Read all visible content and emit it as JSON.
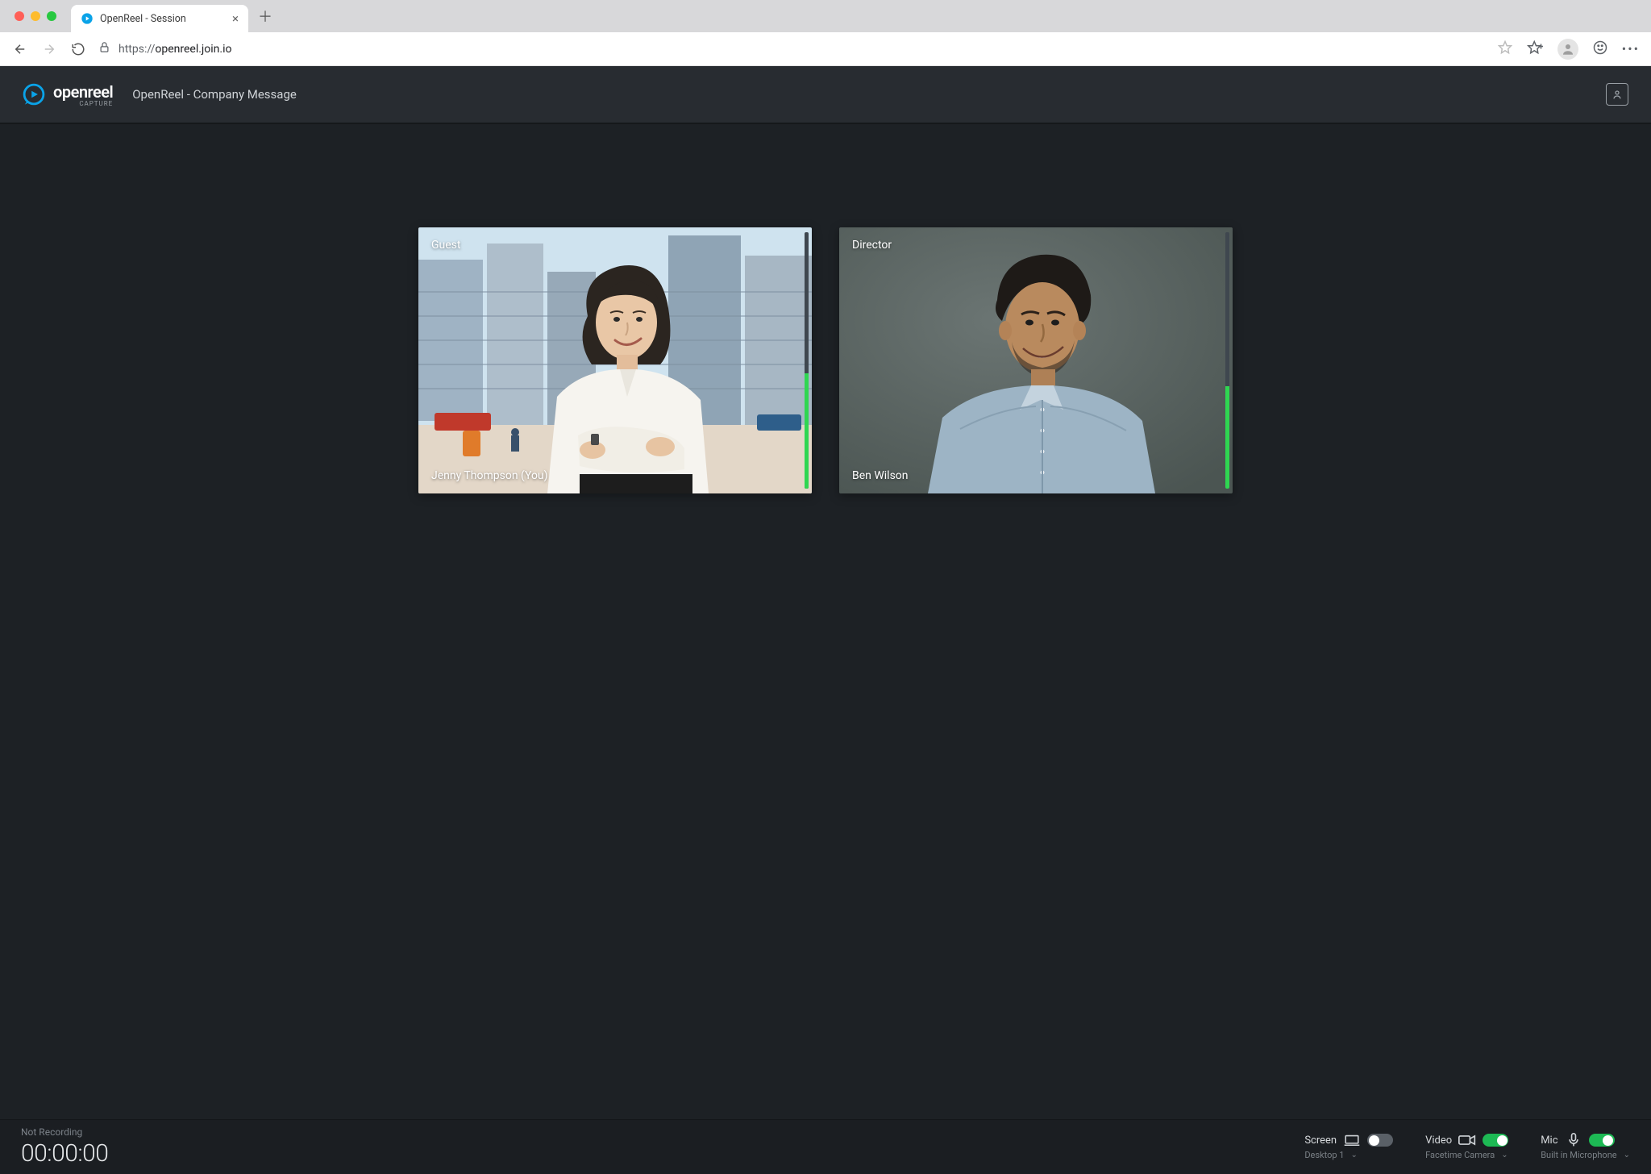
{
  "browser": {
    "tab_title": "OpenReel - Session",
    "url_protocol": "https://",
    "url_rest": "openreel.join.io"
  },
  "header": {
    "brand": "openreel",
    "brand_sub": "CAPTURE",
    "session_title": "OpenReel - Company Message"
  },
  "tiles": [
    {
      "role": "Guest",
      "name": "Jenny Thompson (You)",
      "vu_level_pct": 45
    },
    {
      "role": "Director",
      "name": "Ben Wilson",
      "vu_level_pct": 40
    }
  ],
  "footer": {
    "status": "Not Recording",
    "timer": "00:00:00",
    "controls": {
      "screen": {
        "label": "Screen",
        "device": "Desktop 1",
        "on": false
      },
      "video": {
        "label": "Video",
        "device": "Facetime Camera",
        "on": true
      },
      "mic": {
        "label": "Mic",
        "device": "Built in Microphone",
        "on": true
      }
    }
  }
}
